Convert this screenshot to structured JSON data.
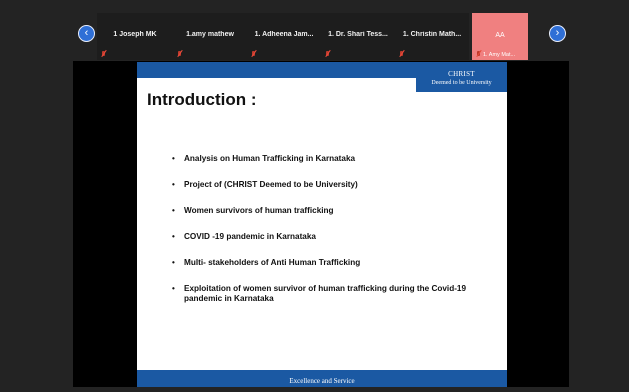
{
  "nav": {
    "prev_icon": "chevron-left-icon",
    "next_icon": "chevron-right-icon",
    "prev_symbol": "‹",
    "next_symbol": "›"
  },
  "participants": [
    {
      "name": "1 Joseph MK"
    },
    {
      "name": "1.amy mathew"
    },
    {
      "name": "1. Adheena Jam..."
    },
    {
      "name": "1. Dr. Shari Tess..."
    },
    {
      "name": "1. Christin Math..."
    }
  ],
  "active_participant": {
    "initials": "AA",
    "name": "1. Amy Mat..."
  },
  "slide": {
    "header": {
      "logo_line1": "CHRIST",
      "logo_line2": "Deemed to be University"
    },
    "title": "Introduction :",
    "bullets": [
      "Analysis on Human Trafficking in Karnataka",
      "Project of (CHRIST Deemed to be University)",
      "Women survivors of human trafficking",
      "COVID -19 pandemic in Karnataka",
      "Multi- stakeholders of Anti Human Trafficking",
      "Exploitation of women survivor of human trafficking during the Covid-19 pandemic in Karnataka"
    ],
    "footer": "Excellence and Service"
  },
  "colors": {
    "background": "#232323",
    "slide_blue": "#1b59a3",
    "active_tile": "#f08080",
    "nav_button": "#2f6fd6"
  }
}
